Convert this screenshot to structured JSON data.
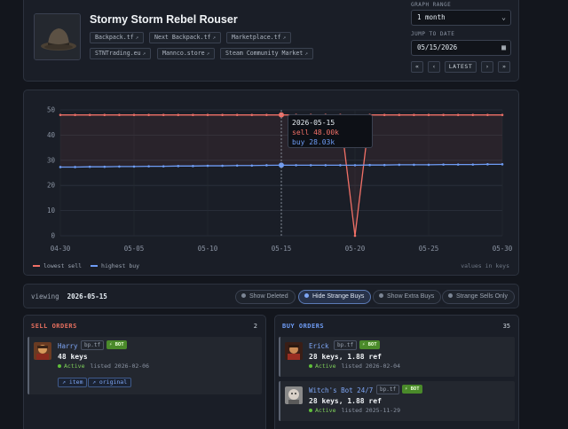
{
  "header": {
    "title": "Stormy Storm Rebel Rouser",
    "links": [
      {
        "label": "Backpack.tf"
      },
      {
        "label": "Next Backpack.tf"
      },
      {
        "label": "Marketplace.tf"
      },
      {
        "label": "STNTrading.eu"
      },
      {
        "label": "Mannco.store"
      },
      {
        "label": "Steam Community Market"
      }
    ],
    "external_icon": "external-link-icon",
    "graph_range_label": "GRAPH RANGE",
    "graph_range_value": "1 month",
    "jump_label": "JUMP TO DATE",
    "jump_value": "05/15/2026",
    "nav": {
      "first": "«",
      "prev": "‹",
      "latest": "LATEST",
      "next": "›",
      "last": "»"
    }
  },
  "chart_data": {
    "type": "line",
    "x": [
      "2026-04-30",
      "2026-05-01",
      "2026-05-02",
      "2026-05-03",
      "2026-05-04",
      "2026-05-05",
      "2026-05-06",
      "2026-05-07",
      "2026-05-08",
      "2026-05-09",
      "2026-05-10",
      "2026-05-11",
      "2026-05-12",
      "2026-05-13",
      "2026-05-14",
      "2026-05-15",
      "2026-05-16",
      "2026-05-17",
      "2026-05-18",
      "2026-05-19",
      "2026-05-20",
      "2026-05-21",
      "2026-05-22",
      "2026-05-23",
      "2026-05-24",
      "2026-05-25",
      "2026-05-26",
      "2026-05-27",
      "2026-05-28",
      "2026-05-29",
      "2026-05-30"
    ],
    "x_tick_labels": [
      "04-30",
      "05-05",
      "05-10",
      "05-15",
      "05-20",
      "05-25",
      "05-30"
    ],
    "series": [
      {
        "name": "lowest sell",
        "color": "#f07067",
        "values": [
          48,
          48,
          48,
          48,
          48,
          48,
          48,
          48,
          48,
          48,
          48,
          48,
          48,
          48,
          48,
          48,
          48,
          48,
          48,
          48,
          0,
          48,
          48,
          48,
          48,
          48,
          48,
          48,
          48,
          48,
          48
        ]
      },
      {
        "name": "highest buy",
        "color": "#6e9cf5",
        "values": [
          27.3,
          27.3,
          27.4,
          27.4,
          27.5,
          27.5,
          27.6,
          27.6,
          27.7,
          27.7,
          27.8,
          27.8,
          27.9,
          27.9,
          28.0,
          28.03,
          28.03,
          28.03,
          28.03,
          28.03,
          28.03,
          28.1,
          28.1,
          28.2,
          28.2,
          28.2,
          28.3,
          28.3,
          28.3,
          28.4,
          28.4
        ]
      }
    ],
    "ylim": [
      0,
      50
    ],
    "y_ticks": [
      0,
      10,
      20,
      30,
      40,
      50
    ],
    "grid": true,
    "legend": "bottom-left",
    "units_note": "values in keys",
    "marker_date": "2026-05-15",
    "tooltip": {
      "date": "2026-05-15",
      "sell": "sell 48.00k",
      "buy": "buy 28.03k"
    }
  },
  "filter_bar": {
    "viewing_label": "viewing",
    "viewing_date": "2026-05-15",
    "toggles": [
      {
        "label": "Show Deleted",
        "active": false
      },
      {
        "label": "Hide Strange Buys",
        "active": true
      },
      {
        "label": "Show Extra Buys",
        "active": false
      },
      {
        "label": "Strange Sells Only",
        "active": false
      }
    ]
  },
  "sell_orders": {
    "title": "SELL ORDERS",
    "title_color": "#e8705f",
    "count": "2",
    "items": [
      {
        "user": "Harry",
        "tag": "bp.tf",
        "bot": "⚡ BOT",
        "price": "48 keys",
        "status": "Active",
        "listed": "listed 2026-02-06",
        "links": [
          {
            "label": "item"
          },
          {
            "label": "original"
          }
        ]
      }
    ]
  },
  "buy_orders": {
    "title": "BUY ORDERS",
    "title_color": "#6e9cf5",
    "count": "35",
    "items": [
      {
        "user": "Erick",
        "tag": "bp.tf",
        "bot": "⚡ BOT",
        "price": "28 keys, 1.88 ref",
        "status": "Active",
        "listed": "listed 2026-02-04"
      },
      {
        "user": "Witch's Bot 24/7",
        "tag": "bp.tf",
        "bot": "⚡ BOT",
        "price": "28 keys, 1.88 ref",
        "status": "Active",
        "listed": "listed 2025-11-29"
      }
    ]
  }
}
